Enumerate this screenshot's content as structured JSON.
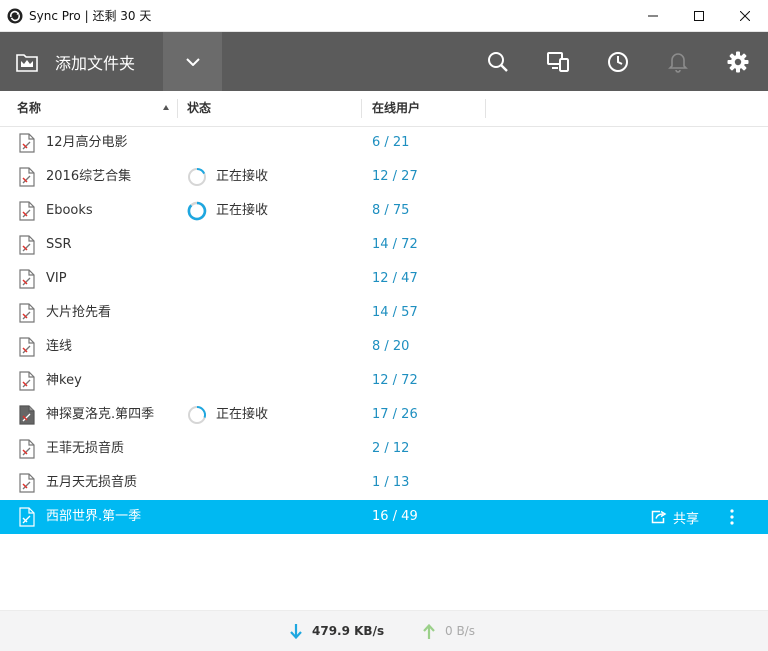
{
  "window": {
    "title": "Sync Pro | 还剩 30 天"
  },
  "toolbar": {
    "add_folder_label": "添加文件夹"
  },
  "columns": {
    "name": "名称",
    "status": "状态",
    "online_users": "在线用户"
  },
  "folders": [
    {
      "name": "12月高分电影",
      "status": "",
      "users": "6 / 21"
    },
    {
      "name": "2016综艺合集",
      "status": "正在接收",
      "users": "12 / 27"
    },
    {
      "name": "Ebooks",
      "status": "正在接收",
      "users": "8 / 75"
    },
    {
      "name": "SSR",
      "status": "",
      "users": "14 / 72"
    },
    {
      "name": "VIP",
      "status": "",
      "users": "12 / 47"
    },
    {
      "name": "大片抢先看",
      "status": "",
      "users": "14 / 57"
    },
    {
      "name": "连线",
      "status": "",
      "users": "8 / 20"
    },
    {
      "name": "神key",
      "status": "",
      "users": "12 / 72"
    },
    {
      "name": "神探夏洛克.第四季",
      "status": "正在接收",
      "users": "17 / 26"
    },
    {
      "name": "王菲无损音质",
      "status": "",
      "users": "2 / 12"
    },
    {
      "name": "五月天无损音质",
      "status": "",
      "users": "1 / 13"
    },
    {
      "name": "西部世界.第一季",
      "status": "",
      "users": "16 / 49"
    }
  ],
  "selected_row": {
    "share_label": "共享"
  },
  "transfer": {
    "download_speed": "479.9 KB/s",
    "upload_speed": "0 B/s"
  },
  "colors": {
    "toolbar_bg": "#5b5b5b",
    "selected_row": "#00b9f2",
    "user_count": "#1e8fc0",
    "download_arrow": "#1ea7e0",
    "upload_arrow": "#9bd08a"
  }
}
